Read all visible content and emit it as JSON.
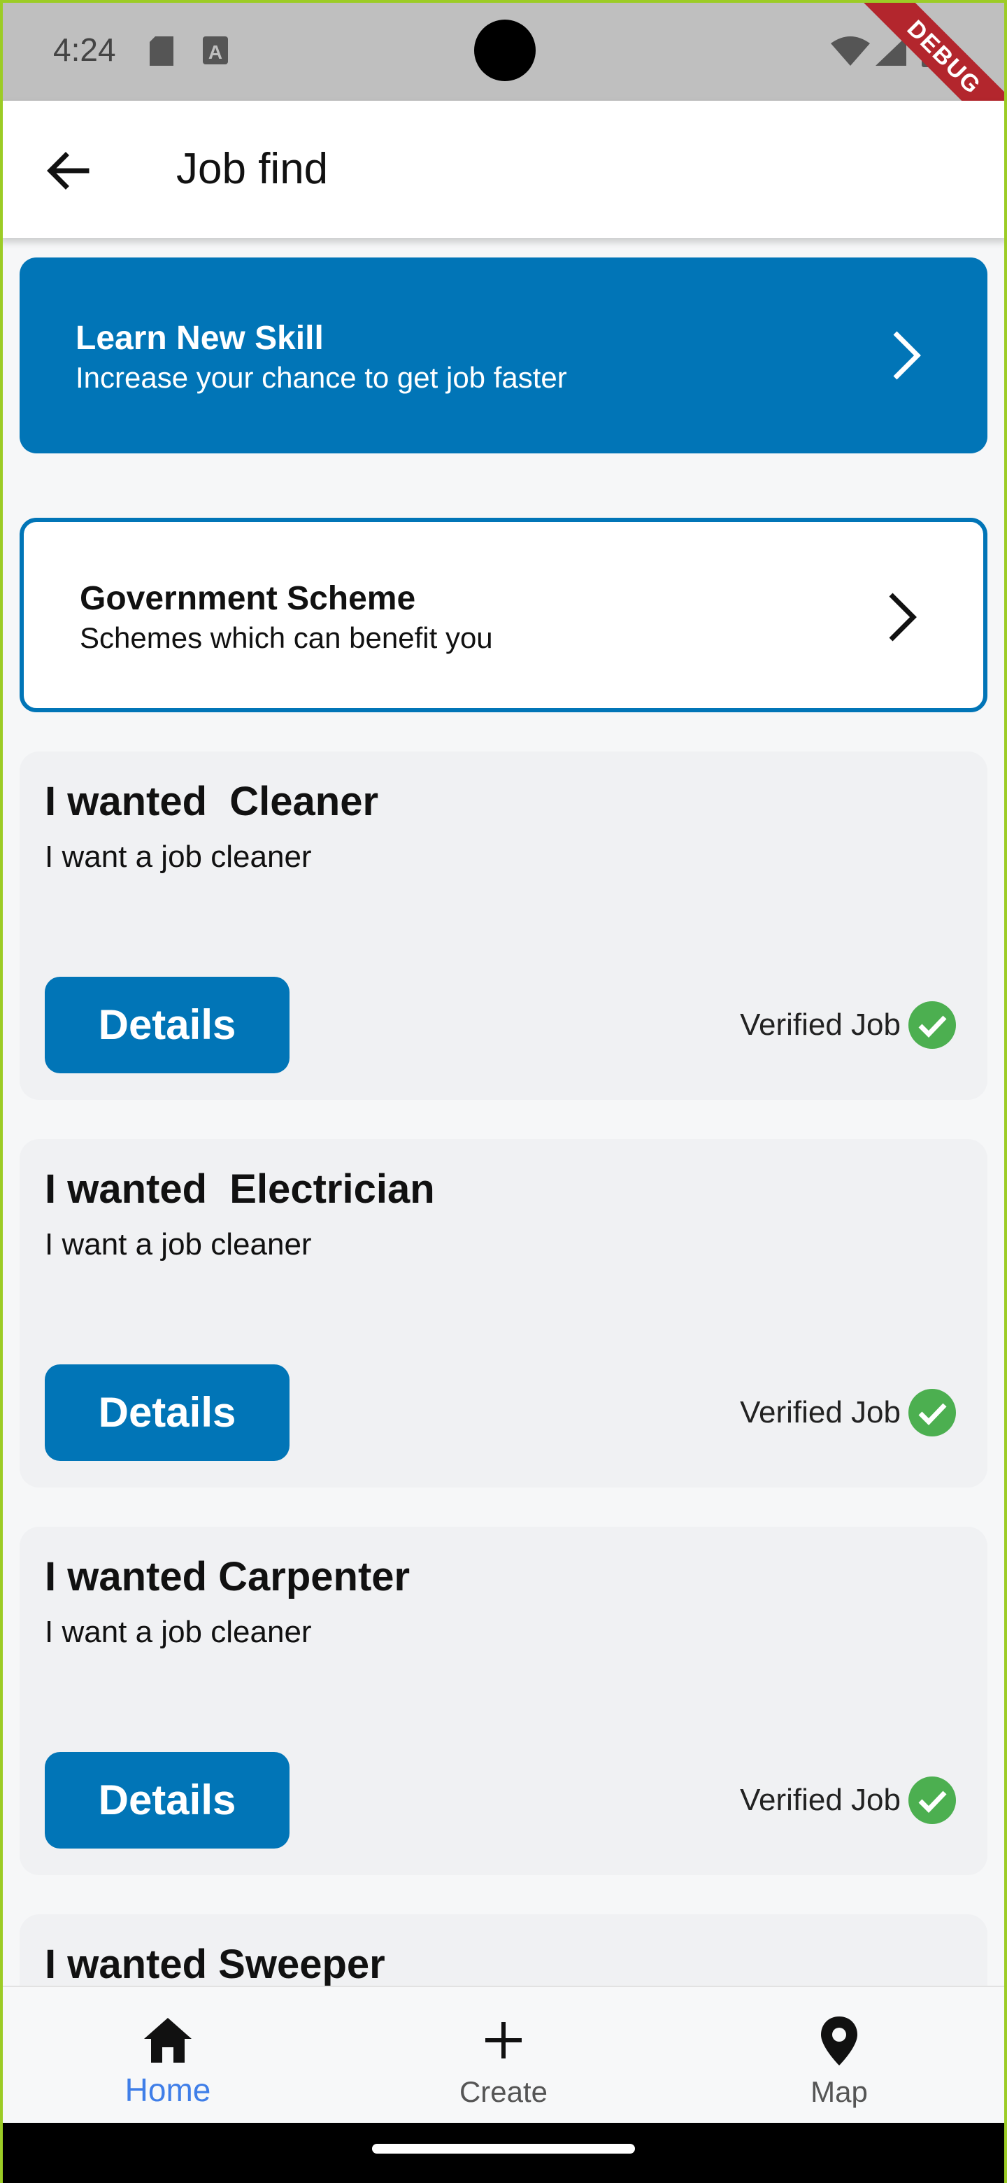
{
  "status_bar": {
    "time": "4:24"
  },
  "debug_label": "DEBUG",
  "app_bar": {
    "title": "Job find"
  },
  "banners": [
    {
      "title": "Learn New Skill",
      "subtitle": "Increase your chance to get job faster"
    },
    {
      "title": "Government Scheme",
      "subtitle": "Schemes which can benefit you"
    }
  ],
  "jobs": [
    {
      "title": "I wanted  Cleaner",
      "description": "I want a job cleaner",
      "button": "Details",
      "verified": "Verified Job"
    },
    {
      "title": "I wanted  Electrician",
      "description": "I want a job cleaner",
      "button": "Details",
      "verified": "Verified Job"
    },
    {
      "title": "I wanted Carpenter",
      "description": "I want a job cleaner",
      "button": "Details",
      "verified": "Verified Job"
    },
    {
      "title": "I wanted Sweeper"
    }
  ],
  "bottom_nav": [
    {
      "label": "Home",
      "active": true
    },
    {
      "label": "Create",
      "active": false
    },
    {
      "label": "Map",
      "active": false
    }
  ],
  "colors": {
    "primary": "#0175b7",
    "verified": "#4caf50",
    "nav_active": "#3f7ee8"
  }
}
